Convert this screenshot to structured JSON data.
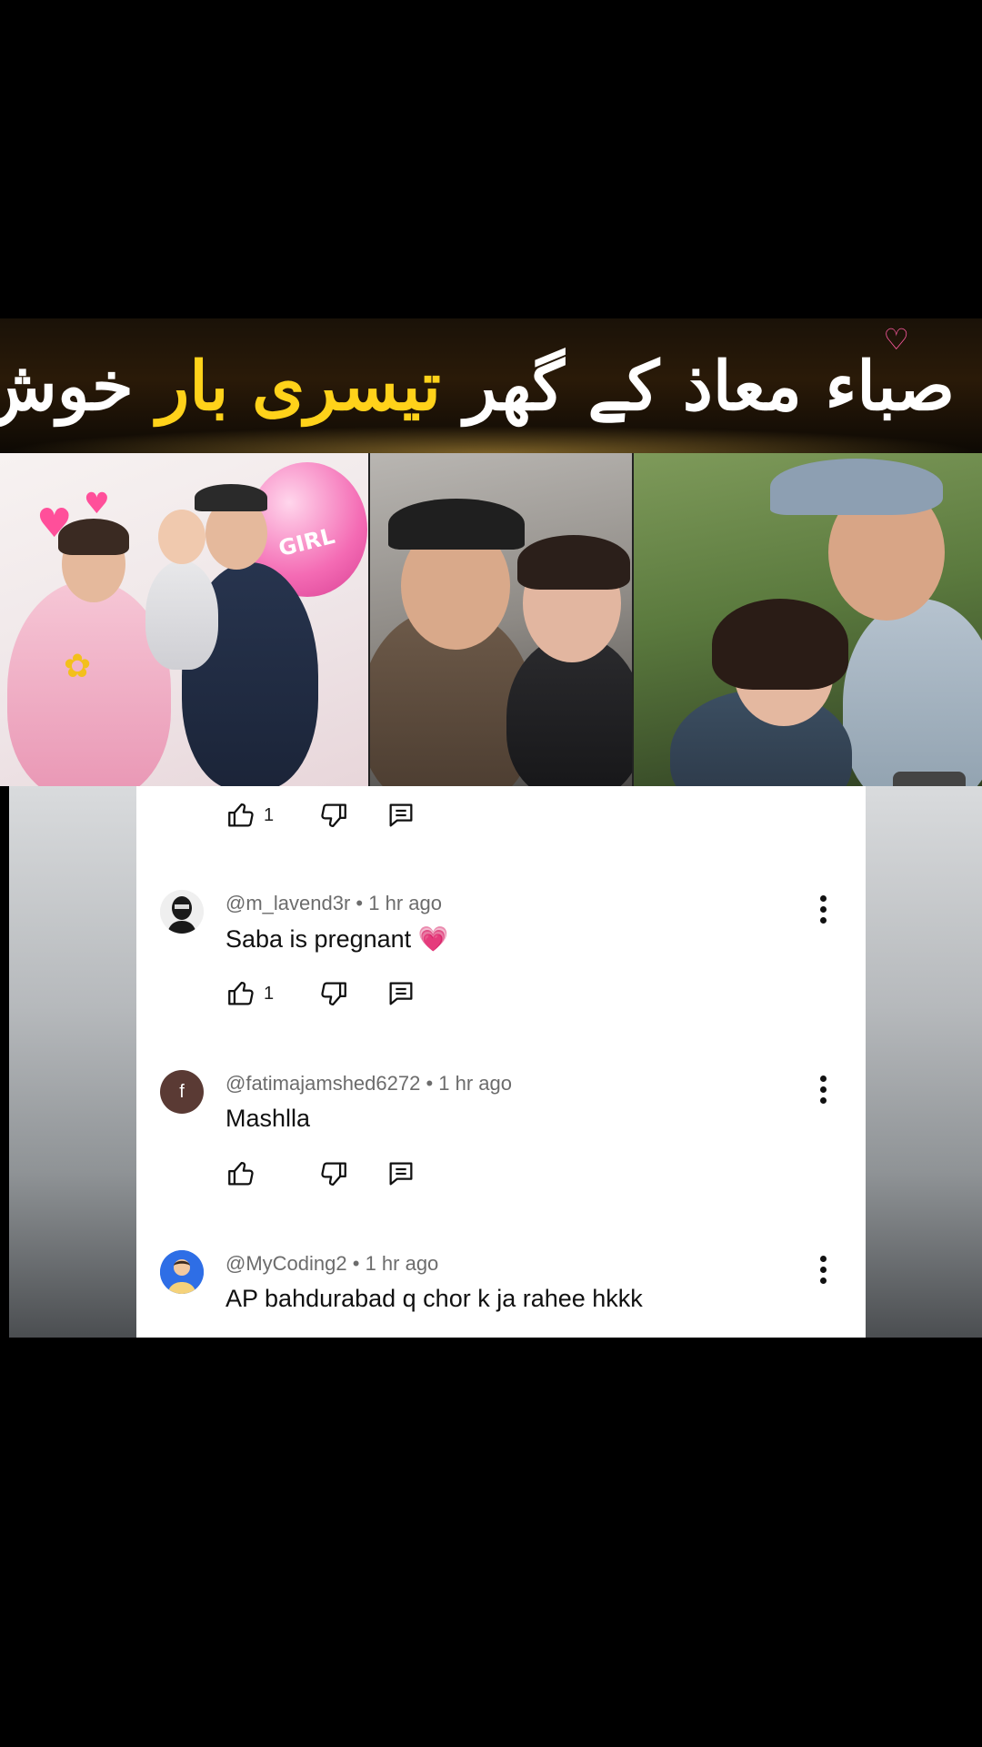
{
  "banner": {
    "title_segments": [
      {
        "text": "صباء معاذ کے گھر ",
        "color": "#ffffff"
      },
      {
        "text": "تیسری بار",
        "color": "#ffd21a"
      },
      {
        "text": " خوش خبری",
        "color": "#ffffff"
      }
    ]
  },
  "photos": {
    "balloon_text": "GIRL"
  },
  "comments": [
    {
      "author": "@m_lavend3r",
      "time": "1 hr ago",
      "text": "Saba is pregnant 💗",
      "likes": "1",
      "avatar_icon": "masked-person-avatar"
    },
    {
      "author": "@fatimajamshed6272",
      "time": "1 hr ago",
      "text": "Mashlla",
      "likes": "",
      "avatar_letter": "f",
      "avatar_color": "#5a3a34"
    },
    {
      "author": "@MyCoding2",
      "time": "1 hr ago",
      "text": "AP bahdurabad q chor k ja rahee hkkk",
      "likes": "",
      "avatar_icon": "cartoon-person-avatar"
    }
  ],
  "top_actions": {
    "likes": "1"
  },
  "icons": {
    "like": "thumbs-up-icon",
    "dislike": "thumbs-down-icon",
    "reply": "reply-comment-icon",
    "more": "more-vertical-icon"
  }
}
